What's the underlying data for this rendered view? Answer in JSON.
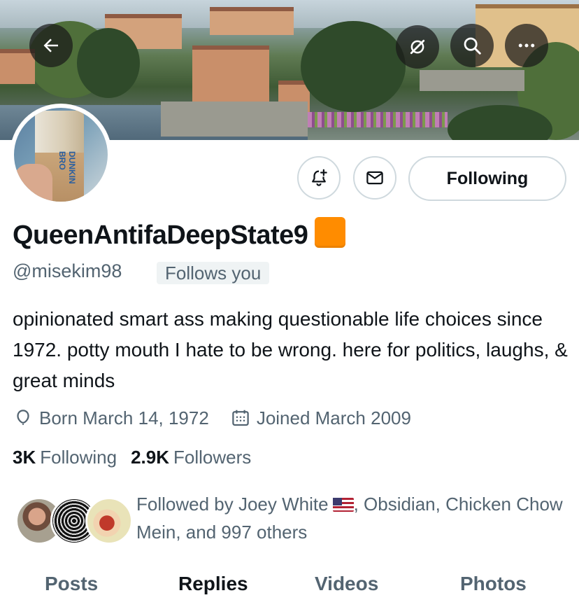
{
  "header": {
    "back_icon": "arrow-left-icon",
    "grok_icon": "grok-slash-icon",
    "search_icon": "search-icon",
    "more_icon": "more-horizontal-icon"
  },
  "actions": {
    "notify_icon": "bell-plus-icon",
    "message_icon": "envelope-icon",
    "following_label": "Following"
  },
  "profile": {
    "display_name": "QueenAntifaDeepState9",
    "badge_color": "#ff8c00",
    "handle": "@misekim98",
    "follows_you": "Follows you",
    "bio": "opinionated smart ass making questionable life choices since 1972. potty mouth I hate to be wrong. here for politics, laughs, & great minds",
    "born": "Born March 14, 1972",
    "joined": "Joined March 2009",
    "avatar_text": "DUNKIN BRO"
  },
  "stats": {
    "following_count": "3K",
    "following_label": "Following",
    "followers_count": "2.9K",
    "followers_label": "Followers"
  },
  "followed_by": {
    "prefix": "Followed by Joey White",
    "suffix": ", Obsidian, Chicken Chow Mein, and 997 others"
  },
  "tabs": [
    "Posts",
    "Replies",
    "Videos",
    "Photos"
  ],
  "active_tab": "Replies",
  "colors": {
    "text_primary": "#0f1419",
    "text_secondary": "#536471",
    "border": "#cfd9de"
  }
}
